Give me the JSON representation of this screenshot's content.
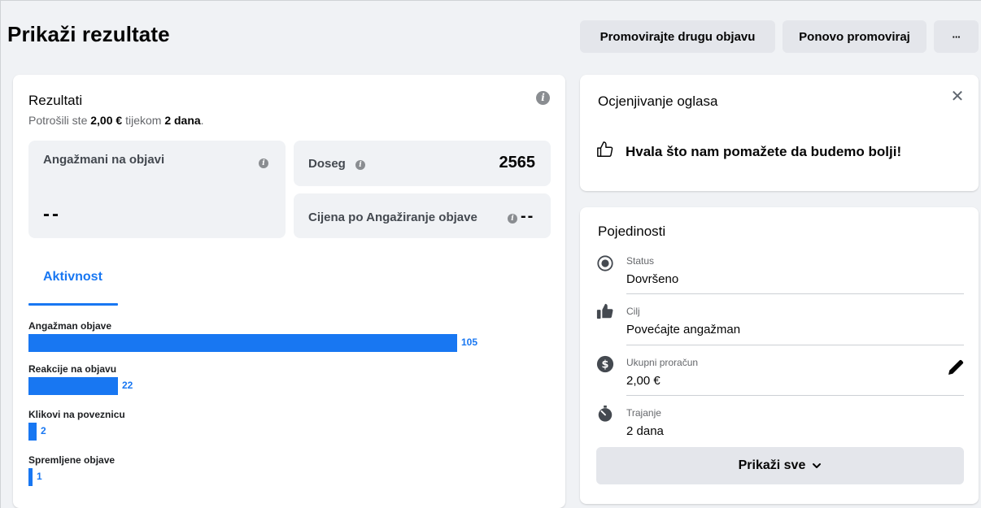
{
  "header": {
    "title": "Prikaži rezultate",
    "buttons": {
      "promote_other": "Promovirajte drugu objavu",
      "repromote": "Ponovo promoviraj",
      "more": "···"
    }
  },
  "results": {
    "title": "Rezultati",
    "spent_prefix": "Potrošili ste ",
    "spent_amount": "2,00 €",
    "spent_mid": " tijekom ",
    "spent_days": "2 dana",
    "spent_suffix": ".",
    "engagements_label": "Angažmani na objavi",
    "engagements_value": "--",
    "reach_label": "Doseg",
    "reach_value": "2565",
    "cost_label": "Cijena po Angažiranje objave",
    "cost_value": "--",
    "tab_activity": "Aktivnost",
    "bars": [
      {
        "label": "Angažman objave",
        "value": 105
      },
      {
        "label": "Reakcije na objavu",
        "value": 22
      },
      {
        "label": "Klikovi na poveznicu",
        "value": 2
      },
      {
        "label": "Spremljene objave",
        "value": 1
      }
    ]
  },
  "rating": {
    "title": "Ocjenjivanje oglasa",
    "message": "Hvala što nam pomažete da budemo bolji!"
  },
  "details": {
    "title": "Pojedinosti",
    "status_label": "Status",
    "status_value": "Dovršeno",
    "goal_label": "Cilj",
    "goal_value": "Povećajte angažman",
    "budget_label": "Ukupni proračun",
    "budget_value": "2,00 €",
    "duration_label": "Trajanje",
    "duration_value": "2 dana",
    "show_all": "Prikaži sve"
  },
  "colors": {
    "accent": "#1877f2",
    "page_bg": "#f0f2f5",
    "button_bg": "#e4e6eb"
  }
}
